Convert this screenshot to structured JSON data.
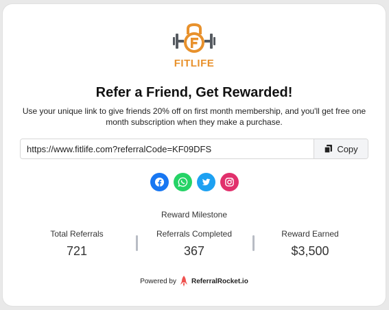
{
  "brand": {
    "name": "FITLIFE",
    "color": "#e8912c",
    "dumbbell_color": "#555a60"
  },
  "headline": "Refer a Friend, Get Rewarded!",
  "description": "Use your unique link to give friends 20% off on first month membership, and you'll get free one month subscription when they make a purchase.",
  "referral": {
    "link": "https://www.fitlife.com?referralCode=KF09DFS",
    "copy_label": "Copy",
    "copy_icon": "copy-icon"
  },
  "share": [
    {
      "name": "facebook-icon",
      "color": "#1877f2"
    },
    {
      "name": "whatsapp-icon",
      "color": "#25d366"
    },
    {
      "name": "twitter-icon",
      "color": "#1da1f2"
    },
    {
      "name": "instagram-icon",
      "color": "#e1306c"
    }
  ],
  "milestone": {
    "title": "Reward Milestone",
    "stats": [
      {
        "label": "Total Referrals",
        "value": "721"
      },
      {
        "label": "Referrals Completed",
        "value": "367"
      },
      {
        "label": "Reward Earned",
        "value": "$3,500"
      }
    ]
  },
  "footer": {
    "prefix": "Powered by",
    "brand": "ReferralRocket.io",
    "rocket_color": "#ef5350"
  }
}
